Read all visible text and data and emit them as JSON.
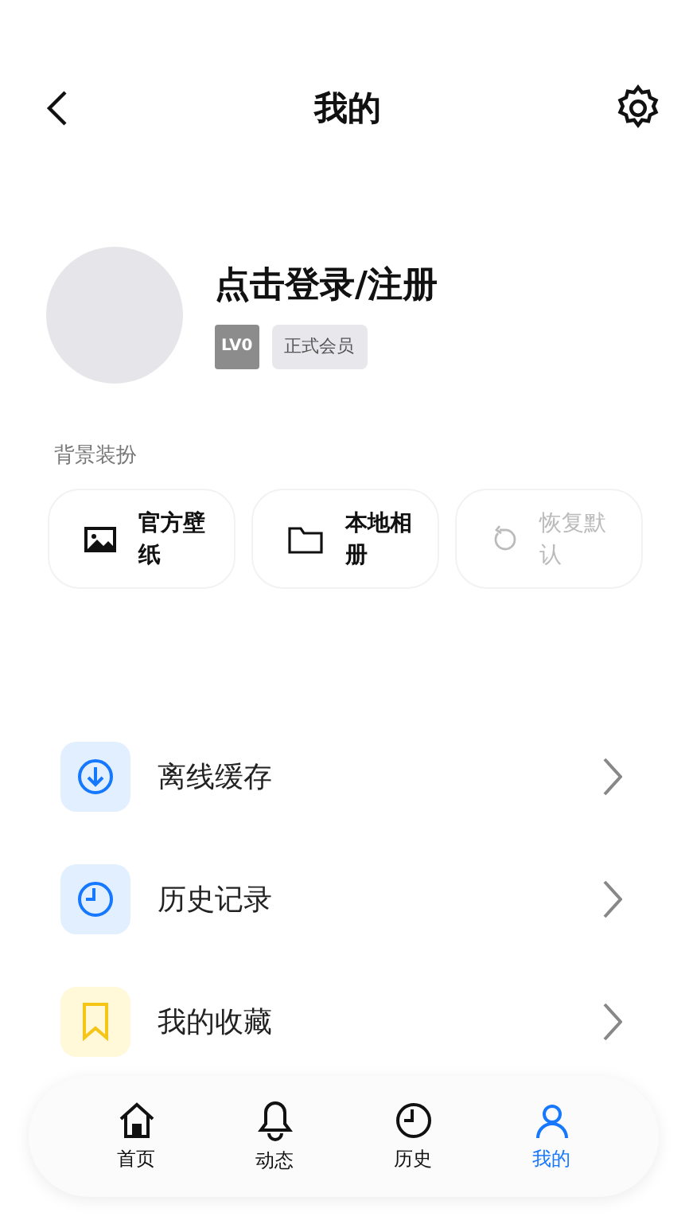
{
  "header": {
    "title": "我的"
  },
  "profile": {
    "name": "点击登录/注册",
    "level": "LV0",
    "member": "正式会员"
  },
  "background": {
    "title": "背景装扮",
    "actions": [
      {
        "kind": "wallpaper",
        "label": "官方壁纸",
        "disabled": false
      },
      {
        "kind": "album",
        "label": "本地相册",
        "disabled": false
      },
      {
        "kind": "reset",
        "label": "恢复默认",
        "disabled": true
      }
    ]
  },
  "menu": [
    {
      "kind": "download",
      "label": "离线缓存"
    },
    {
      "kind": "history",
      "label": "历史记录"
    },
    {
      "kind": "favorite",
      "label": "我的收藏"
    }
  ],
  "tabs": [
    {
      "kind": "home",
      "label": "首页",
      "selected": false
    },
    {
      "kind": "bell",
      "label": "动态",
      "selected": false
    },
    {
      "kind": "history",
      "label": "历史",
      "selected": false
    },
    {
      "kind": "user",
      "label": "我的",
      "selected": true
    }
  ]
}
